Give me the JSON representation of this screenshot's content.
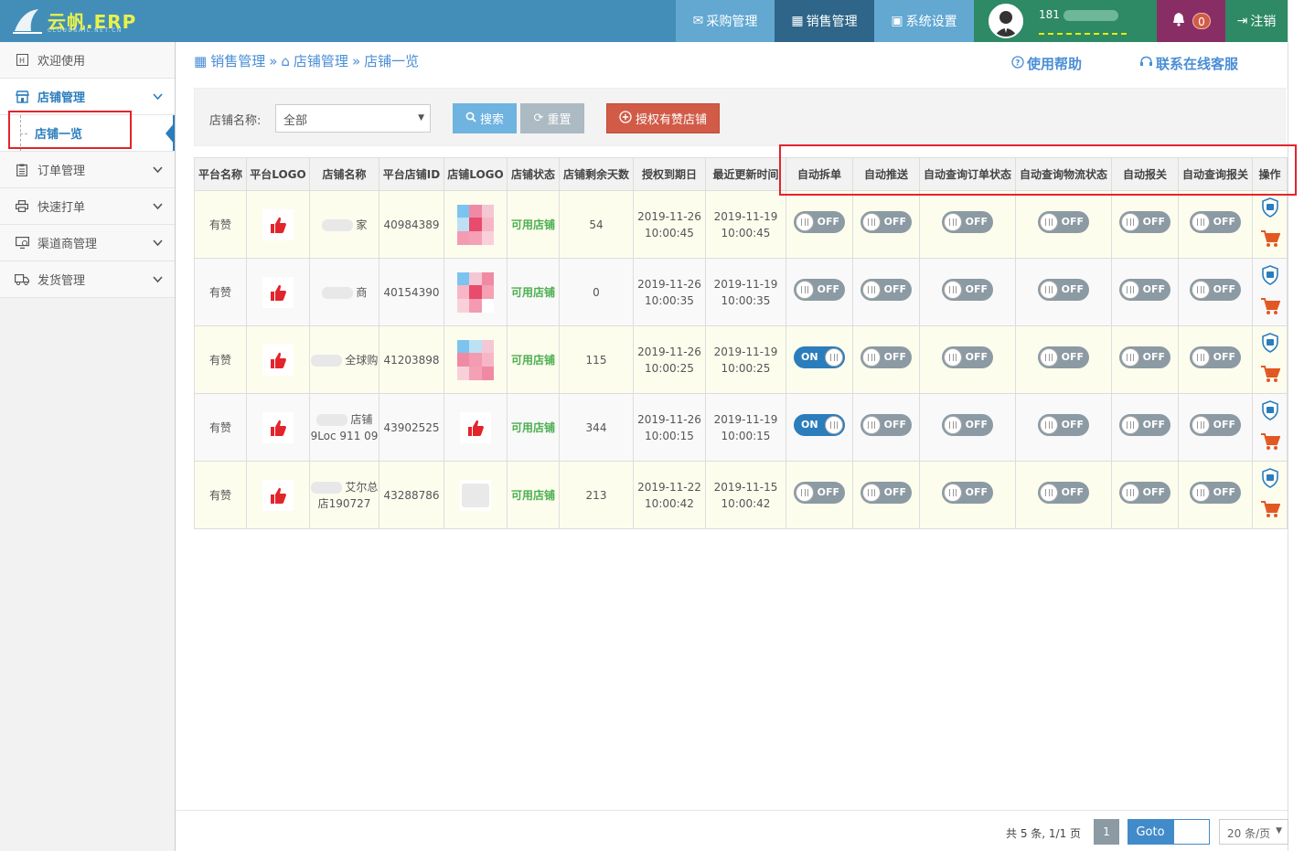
{
  "header": {
    "logo_text": "云帆.ERP",
    "logo_sub": "CLOUDSAIL.NET.CN",
    "nav": {
      "purchase": "采购管理",
      "sales": "销售管理",
      "settings": "系统设置"
    },
    "user_id_partial": "181",
    "bell_count": "0",
    "logout": "注销"
  },
  "sidebar": {
    "items": [
      {
        "label": "欢迎使用",
        "icon": "welcome-icon"
      },
      {
        "label": "店铺管理",
        "icon": "store-icon"
      },
      {
        "label": "订单管理",
        "icon": "order-icon"
      },
      {
        "label": "快速打单",
        "icon": "printer-icon"
      },
      {
        "label": "渠道商管理",
        "icon": "channel-icon"
      },
      {
        "label": "发货管理",
        "icon": "truck-icon"
      }
    ],
    "sub_active": "店铺一览"
  },
  "breadcrumb": {
    "l1": "销售管理",
    "l2": "店铺管理",
    "l3": "店铺一览",
    "sep": "»"
  },
  "top_links": {
    "help": "使用帮助",
    "cs": "联系在线客服"
  },
  "filter": {
    "label": "店铺名称:",
    "select_value": "全部",
    "search": "搜索",
    "reset": "重置",
    "authorize": "授权有赞店铺"
  },
  "table": {
    "headers": [
      "平台名称",
      "平台LOGO",
      "店铺名称",
      "平台店铺ID",
      "店铺LOGO",
      "店铺状态",
      "店铺剩余天数",
      "授权到期日",
      "最近更新时间",
      "自动拆单",
      "自动推送",
      "自动查询订单状态",
      "自动查询物流状态",
      "自动报关",
      "自动查询报关",
      "操作"
    ],
    "rows": [
      {
        "platform": "有赞",
        "name": "家",
        "shop_id": "40984389",
        "status": "可用店铺",
        "days": "54",
        "expire_date": "2019-11-26",
        "expire_time": "10:00:45",
        "update_date": "2019-11-19",
        "update_time": "10:00:45",
        "toggles": [
          "OFF",
          "OFF",
          "OFF",
          "OFF",
          "OFF",
          "OFF"
        ]
      },
      {
        "platform": "有赞",
        "name": "商",
        "shop_id": "40154390",
        "status": "可用店铺",
        "days": "0",
        "expire_date": "2019-11-26",
        "expire_time": "10:00:35",
        "update_date": "2019-11-19",
        "update_time": "10:00:35",
        "toggles": [
          "OFF",
          "OFF",
          "OFF",
          "OFF",
          "OFF",
          "OFF"
        ]
      },
      {
        "platform": "有赞",
        "name": "全球购",
        "shop_id": "41203898",
        "status": "可用店铺",
        "days": "115",
        "expire_date": "2019-11-26",
        "expire_time": "10:00:25",
        "update_date": "2019-11-19",
        "update_time": "10:00:25",
        "toggles": [
          "ON",
          "OFF",
          "OFF",
          "OFF",
          "OFF",
          "OFF"
        ]
      },
      {
        "platform": "有赞",
        "name": "店铺 9Loc 911 09",
        "shop_id": "43902525",
        "status": "可用店铺",
        "days": "344",
        "expire_date": "2019-11-26",
        "expire_time": "10:00:15",
        "update_date": "2019-11-19",
        "update_time": "10:00:15",
        "toggles": [
          "ON",
          "OFF",
          "OFF",
          "OFF",
          "OFF",
          "OFF"
        ]
      },
      {
        "platform": "有赞",
        "name": "艾尔总 店190727",
        "shop_id": "43288786",
        "status": "可用店铺",
        "days": "213",
        "expire_date": "2019-11-22",
        "expire_time": "10:00:42",
        "update_date": "2019-11-15",
        "update_time": "10:00:42",
        "toggles": [
          "OFF",
          "OFF",
          "OFF",
          "OFF",
          "OFF",
          "OFF"
        ]
      }
    ]
  },
  "pager": {
    "info": "共 5 条, 1/1 页",
    "page": "1",
    "goto": "Goto",
    "page_size": "20 条/页"
  },
  "colors": {
    "header_bg": "#438eb9",
    "accent": "#2b7dbc",
    "danger": "#d15b47",
    "status_ok": "#4caf50",
    "highlight": "#e2242c"
  }
}
